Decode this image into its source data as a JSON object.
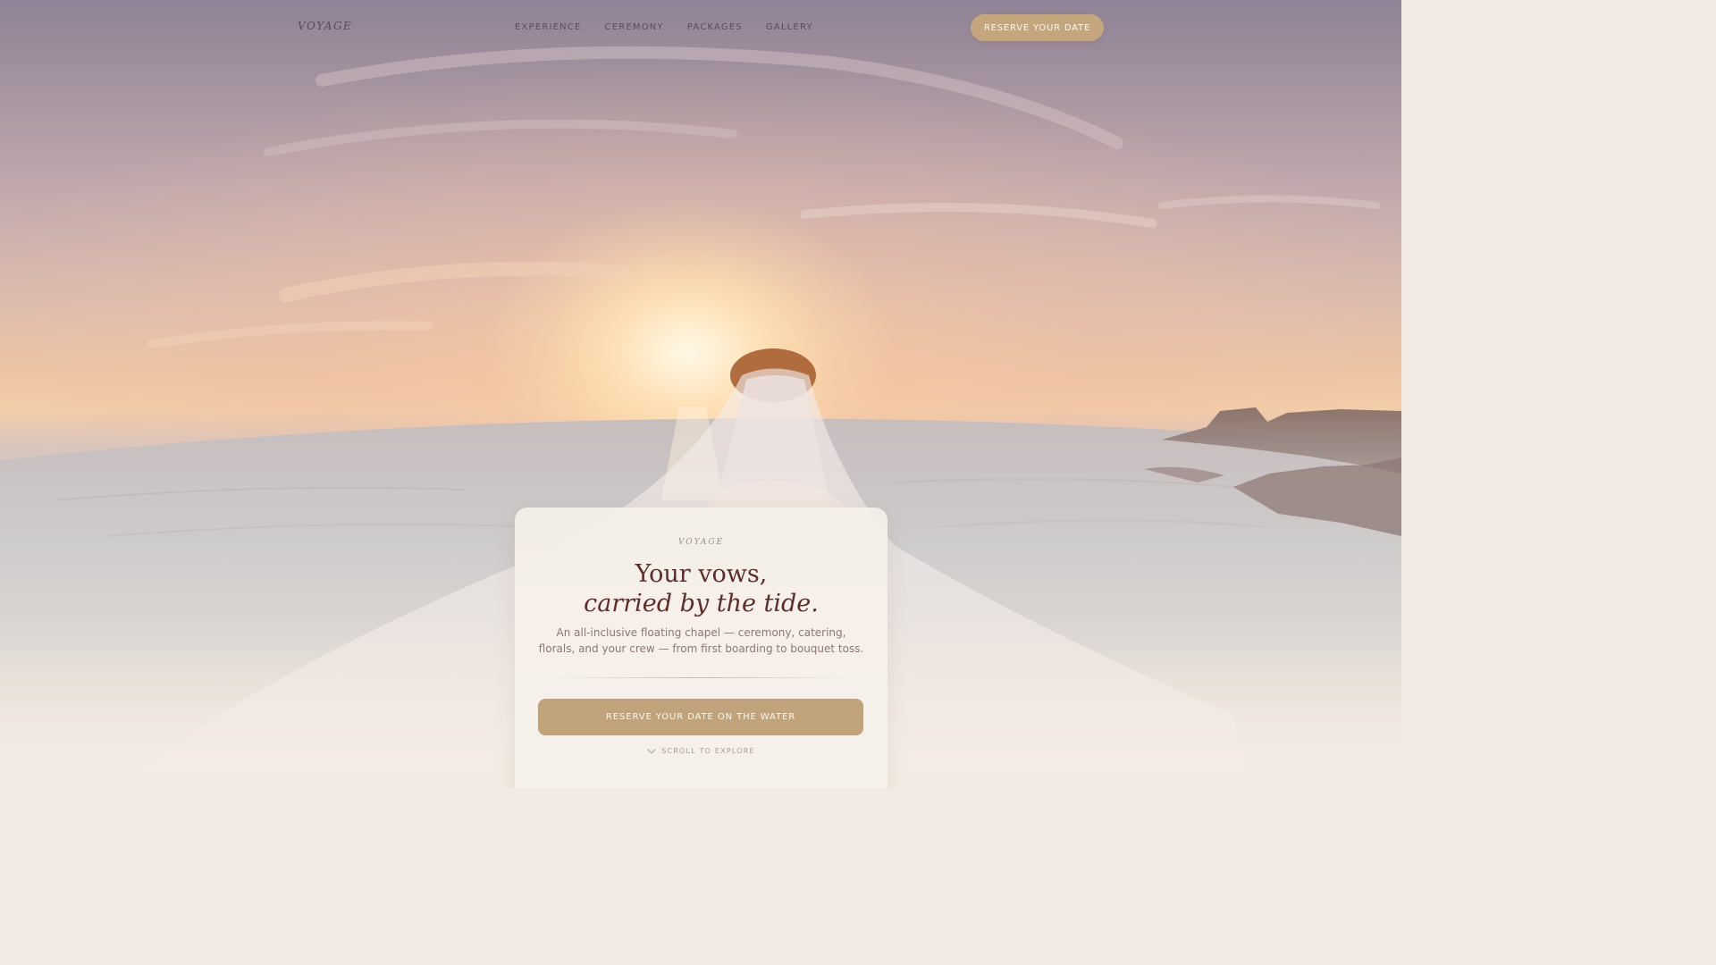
{
  "nav": {
    "logo": "VOYAGE",
    "links": [
      {
        "label": "EXPERIENCE"
      },
      {
        "label": "CEREMONY"
      },
      {
        "label": "PACKAGES"
      },
      {
        "label": "GALLERY"
      }
    ],
    "cta_label": "RESERVE YOUR DATE"
  },
  "card": {
    "eyebrow": "VOYAGE",
    "title_line1": "Your vows,",
    "title_line2": "carried by the tide.",
    "body": "An all-inclusive floating chapel — ceremony, catering, florals, and your crew — from first boarding to bouquet toss.",
    "cta_label": "RESERVE YOUR DATE ON THE WATER",
    "scroll_label": "SCROLL TO EXPLORE"
  },
  "colors": {
    "accent_gold": "#c0a37b",
    "title_maroon": "#5b2e2c",
    "card_bg": "#f6f0ea"
  },
  "icons": {
    "scroll": "chevron-down-icon"
  }
}
